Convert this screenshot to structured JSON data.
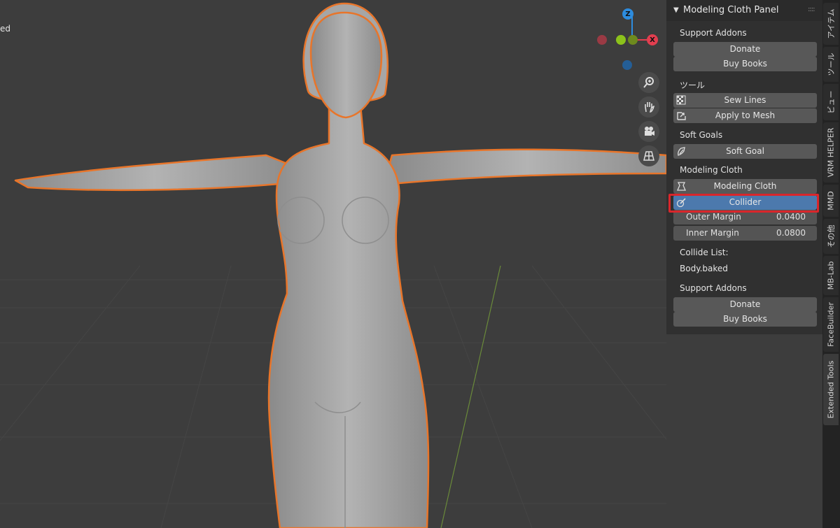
{
  "viewport": {
    "header_text_fragment": "ed",
    "gizmo": {
      "z": "Z",
      "x": "X"
    }
  },
  "panel": {
    "title": "Modeling Cloth Panel",
    "support_addons_1": "Support Addons",
    "donate_1": "Donate",
    "buy_books_1": "Buy Books",
    "tools_label": "ツール",
    "sew_lines": "Sew Lines",
    "apply_to_mesh": "Apply to Mesh",
    "soft_goals_label": "Soft Goals",
    "soft_goal": "Soft Goal",
    "modeling_cloth_label": "Modeling Cloth",
    "modeling_cloth_button": "Modeling Cloth",
    "collider": "Collider",
    "outer_margin_label": "Outer Margin",
    "outer_margin_value": "0.0400",
    "inner_margin_label": "Inner Margin",
    "inner_margin_value": "0.0800",
    "collide_list_label": "Collide List:",
    "collide_item": "Body.baked",
    "support_addons_2": "Support Addons",
    "donate_2": "Donate",
    "buy_books_2": "Buy Books"
  },
  "tabs": [
    {
      "label": "アイテム"
    },
    {
      "label": "ツール"
    },
    {
      "label": "ビュー"
    },
    {
      "label": "VRM HELPER"
    },
    {
      "label": "MMD"
    },
    {
      "label": "その他"
    },
    {
      "label": "MB-Lab"
    },
    {
      "label": "FaceBuilder"
    },
    {
      "label": "Extended Tools"
    }
  ],
  "colors": {
    "accent_active": "#4c79ad",
    "highlight_box": "#d9262b",
    "selection_outline": "#e8752a",
    "axis_x": "#e23e4f",
    "axis_y": "#8cc21b",
    "axis_z": "#2d8cde"
  }
}
